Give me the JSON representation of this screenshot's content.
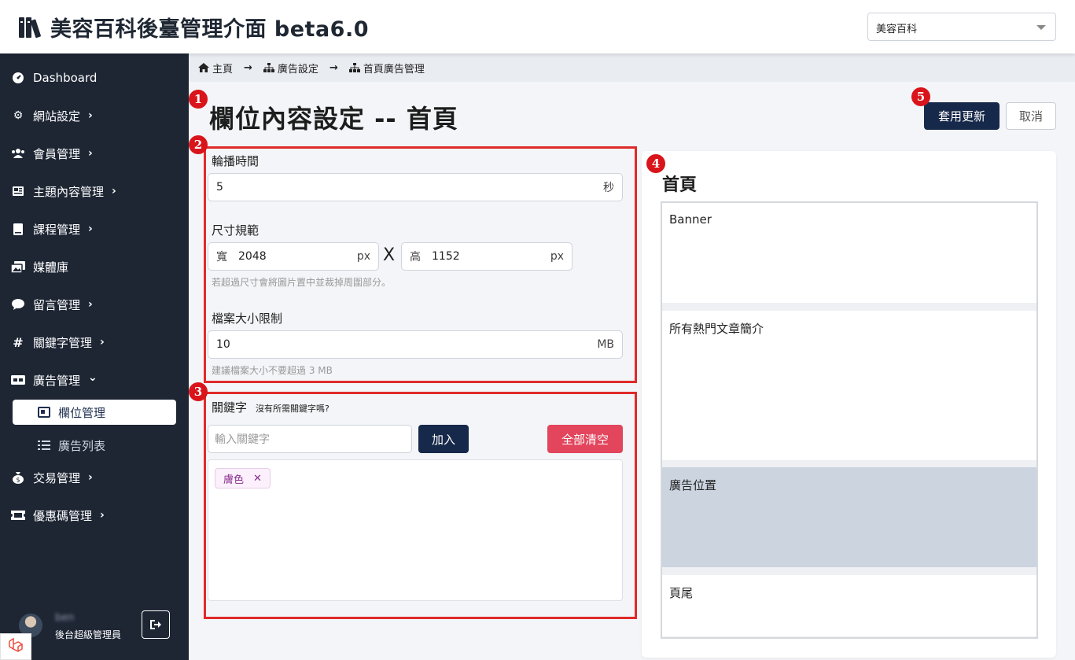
{
  "header": {
    "title": "美容百科後臺管理介面 beta6.0",
    "site_select": "美容百科"
  },
  "sidebar": {
    "items": [
      {
        "label": "Dashboard",
        "icon": "dashboard-icon",
        "chevron": ""
      },
      {
        "label": "網站設定",
        "icon": "gear-icon",
        "chevron": "›"
      },
      {
        "label": "會員管理",
        "icon": "users-icon",
        "chevron": "›"
      },
      {
        "label": "主題內容管理",
        "icon": "newspaper-icon",
        "chevron": "›"
      },
      {
        "label": "課程管理",
        "icon": "book-icon",
        "chevron": "›"
      },
      {
        "label": "媒體庫",
        "icon": "images-icon",
        "chevron": ""
      },
      {
        "label": "留言管理",
        "icon": "comment-icon",
        "chevron": "›"
      },
      {
        "label": "關鍵字管理",
        "icon": "hashtag-icon",
        "chevron": "›"
      },
      {
        "label": "廣告管理",
        "icon": "ad-icon",
        "chevron": "⌄"
      },
      {
        "label": "交易管理",
        "icon": "money-bag-icon",
        "chevron": "›"
      },
      {
        "label": "優惠碼管理",
        "icon": "ticket-icon",
        "chevron": "›"
      }
    ],
    "sub_items": {
      "active": "欄位管理",
      "other": "廣告列表"
    },
    "user": {
      "name": "ben",
      "role": "後台超級管理員"
    }
  },
  "breadcrumb": [
    "主頁",
    "廣告設定",
    "首頁廣告管理"
  ],
  "page": {
    "title": "欄位內容設定 -- 首頁",
    "apply_label": "套用更新",
    "cancel_label": "取消"
  },
  "badges": [
    "1",
    "2",
    "3",
    "4",
    "5"
  ],
  "form": {
    "carousel_label": "輪播時間",
    "carousel_value": "5",
    "carousel_unit": "秒",
    "size_label": "尺寸規範",
    "width_prefix": "寬",
    "width_value": "2048",
    "width_unit": "px",
    "times": "X",
    "height_prefix": "高",
    "height_value": "1152",
    "height_unit": "px",
    "size_hint": "若超過尺寸會將圖片置中並裁掉周圍部分。",
    "filesize_label": "檔案大小限制",
    "filesize_value": "10",
    "filesize_unit": "MB",
    "filesize_hint": "建議檔案大小不要超過 3 MB"
  },
  "keywords": {
    "label": "關鍵字",
    "missing_link": "沒有所需關鍵字嗎?",
    "input_placeholder": "輸入關鍵字",
    "add_label": "加入",
    "clear_label": "全部清空",
    "tags": [
      "膚色"
    ],
    "remove_glyph": "✕"
  },
  "preview": {
    "title": "首頁",
    "slots": [
      "Banner",
      "所有熱門文章簡介",
      "廣告位置",
      "頁尾"
    ],
    "active_slot": "廣告位置"
  },
  "colors": {
    "sidebar_bg": "#1e2634",
    "primary": "#17294a",
    "danger": "#e2455c",
    "annotation_red": "#d9141a",
    "active_slot": "#cbd4df"
  }
}
